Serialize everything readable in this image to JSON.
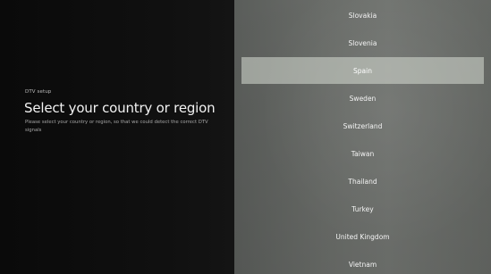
{
  "setup": {
    "label": "DTV setup",
    "title": "Select your country or region",
    "description": "Please select your country or region, so that we could detect the correct DTV signals"
  },
  "countries": [
    {
      "label": "Slovakia",
      "selected": false
    },
    {
      "label": "Slovenia",
      "selected": false
    },
    {
      "label": "Spain",
      "selected": true
    },
    {
      "label": "Sweden",
      "selected": false
    },
    {
      "label": "Switzerland",
      "selected": false
    },
    {
      "label": "Taiwan",
      "selected": false
    },
    {
      "label": "Thailand",
      "selected": false
    },
    {
      "label": "Turkey",
      "selected": false
    },
    {
      "label": "United Kingdom",
      "selected": false
    },
    {
      "label": "Vietnam",
      "selected": false
    }
  ],
  "colors": {
    "left_background": "#0a0a0a",
    "right_background": "#717470",
    "highlight": "#c9cdc6",
    "text": "#f4f4f4"
  }
}
